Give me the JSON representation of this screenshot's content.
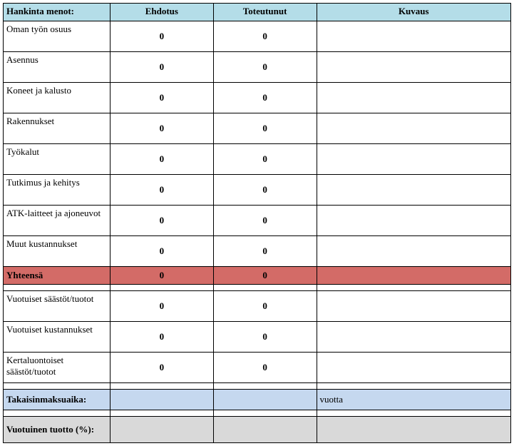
{
  "headers": {
    "col1": "Hankinta menot:",
    "col2": "Ehdotus",
    "col3": "Toteutunut",
    "col4": "Kuvaus"
  },
  "rows": [
    {
      "label": "Oman työn osuus",
      "ehdotus": "0",
      "toteutunut": "0",
      "kuvaus": ""
    },
    {
      "label": "Asennus",
      "ehdotus": "0",
      "toteutunut": "0",
      "kuvaus": ""
    },
    {
      "label": "Koneet ja kalusto",
      "ehdotus": "0",
      "toteutunut": "0",
      "kuvaus": ""
    },
    {
      "label": "Rakennukset",
      "ehdotus": "0",
      "toteutunut": "0",
      "kuvaus": ""
    },
    {
      "label": "Työkalut",
      "ehdotus": "0",
      "toteutunut": "0",
      "kuvaus": ""
    },
    {
      "label": "Tutkimus ja kehitys",
      "ehdotus": "0",
      "toteutunut": "0",
      "kuvaus": ""
    },
    {
      "label": "ATK-laitteet ja ajoneuvot",
      "ehdotus": "0",
      "toteutunut": "0",
      "kuvaus": ""
    },
    {
      "label": "Muut kustannukset",
      "ehdotus": "0",
      "toteutunut": "0",
      "kuvaus": ""
    }
  ],
  "total": {
    "label": "Yhteensä",
    "ehdotus": "0",
    "toteutunut": "0",
    "kuvaus": ""
  },
  "rows2": [
    {
      "label": "Vuotuiset säästöt/tuotot",
      "ehdotus": "0",
      "toteutunut": "0",
      "kuvaus": ""
    },
    {
      "label": "Vuotuiset kustannukset",
      "ehdotus": "0",
      "toteutunut": "0",
      "kuvaus": ""
    },
    {
      "label": "Kertaluontoiset säästöt/tuotot",
      "ehdotus": "0",
      "toteutunut": "0",
      "kuvaus": ""
    }
  ],
  "payback": {
    "label": "Takaisinmaksuaika:",
    "ehdotus": "",
    "toteutunut": "",
    "kuvaus": "vuotta"
  },
  "yield": {
    "label": "Vuotuinen tuotto (%):",
    "ehdotus": "",
    "toteutunut": "",
    "kuvaus": ""
  }
}
